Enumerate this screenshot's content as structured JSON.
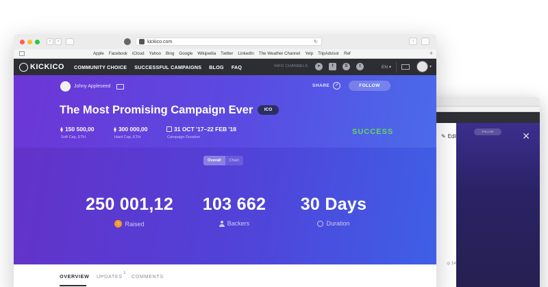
{
  "browser": {
    "url": "kickico.com",
    "bookmarks": [
      "Apple",
      "Facebook",
      "iCloud",
      "Yahoo",
      "Bing",
      "Google",
      "Wikipedia",
      "Twitter",
      "LinkedIn",
      "The Weather Channel",
      "Yelp",
      "TripAdvisor",
      "Ref"
    ]
  },
  "nav": {
    "logo": "KICKICO",
    "menu": [
      "COMMUNITY CHOICE",
      "SUCCESSFUL CAMPAIGNS",
      "BLOG",
      "FAQ"
    ],
    "channels_label": "INFO CHANNELS",
    "socials": [
      "telegram-icon",
      "facebook-icon",
      "skype-icon",
      "twitter-icon"
    ],
    "lang": "EN"
  },
  "campaign": {
    "author": "Johny Appleseed",
    "share_label": "SHARE",
    "follow_label": "FOLLOW",
    "title": "The Most Promising Campaign Ever",
    "badge": "ICO",
    "soft_cap": {
      "value": "150 500,00",
      "label": "Soft Cap, ETH"
    },
    "hard_cap": {
      "value": "300 000,00",
      "label": "Hard Cap, ETH"
    },
    "duration": {
      "value": "31 OCT '17–22 FEB '18",
      "label": "Campaign Duration"
    },
    "status": "SUCCESS",
    "status_color": "#64d85c",
    "view_toggle": [
      "Overall",
      "Chart"
    ],
    "view_selected": "Overall",
    "stats": [
      {
        "value": "250 001,12",
        "label": "Raised"
      },
      {
        "value": "103 662",
        "label": "Backers"
      },
      {
        "value": "30 Days",
        "label": "Duration"
      }
    ]
  },
  "tabs": [
    {
      "label": "OVERVIEW",
      "active": true
    },
    {
      "label": "UPDATES",
      "badge": "3"
    },
    {
      "label": "COMMENTS"
    }
  ],
  "second_window": {
    "edit_label": "Edit",
    "follow_label": "FOLLOW",
    "count": "14"
  }
}
